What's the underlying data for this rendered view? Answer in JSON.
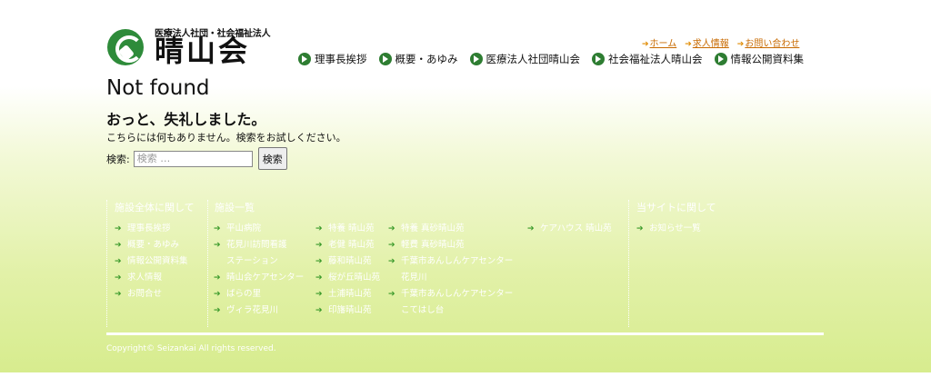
{
  "logo": {
    "subtitle": "医療法人社団・社会福祉法人",
    "name": "晴山会"
  },
  "top_links": [
    "ホーム",
    "求人情報",
    "お問い合わせ"
  ],
  "main_nav": [
    "理事長挨拶",
    "概要・あゆみ",
    "医療法人社団晴山会",
    "社会福祉法人晴山会",
    "情報公開資料集"
  ],
  "content": {
    "title": "Not found",
    "heading": "おっと、失礼しました。",
    "message": "こちらには何もありません。検索をお試しください。"
  },
  "search": {
    "label": "検索:",
    "placeholder": "検索 …",
    "button": "検索"
  },
  "footer": {
    "col1": {
      "title": "施設全体に関して",
      "items": [
        "理事長挨拶",
        "概要・あゆみ",
        "情報公開資料集",
        "求人情報",
        "お問合せ"
      ]
    },
    "col2": {
      "title": "施設一覧",
      "a": [
        "平山病院",
        "花見川訪問看護",
        "ステーション",
        "晴山会ケアセンター",
        "ばらの里",
        "ヴィラ花見川"
      ],
      "b": [
        "特養 晴山苑",
        "老健 晴山苑",
        "藤和晴山苑",
        "桜が丘晴山苑",
        "土浦晴山苑",
        "印旛晴山苑"
      ],
      "c": [
        "特養 真砂晴山苑",
        "軽費 真砂晴山苑",
        "千葉市あんしんケアセンター",
        "花見川",
        "千葉市あんしんケアセンター",
        "こてはし台"
      ],
      "d": [
        "ケアハウス 晴山苑"
      ]
    },
    "col3": {
      "title": "当サイトに関して",
      "items": [
        "お知らせ一覧"
      ]
    },
    "copyright": "Copyright© Seizankai All rights reserved."
  }
}
